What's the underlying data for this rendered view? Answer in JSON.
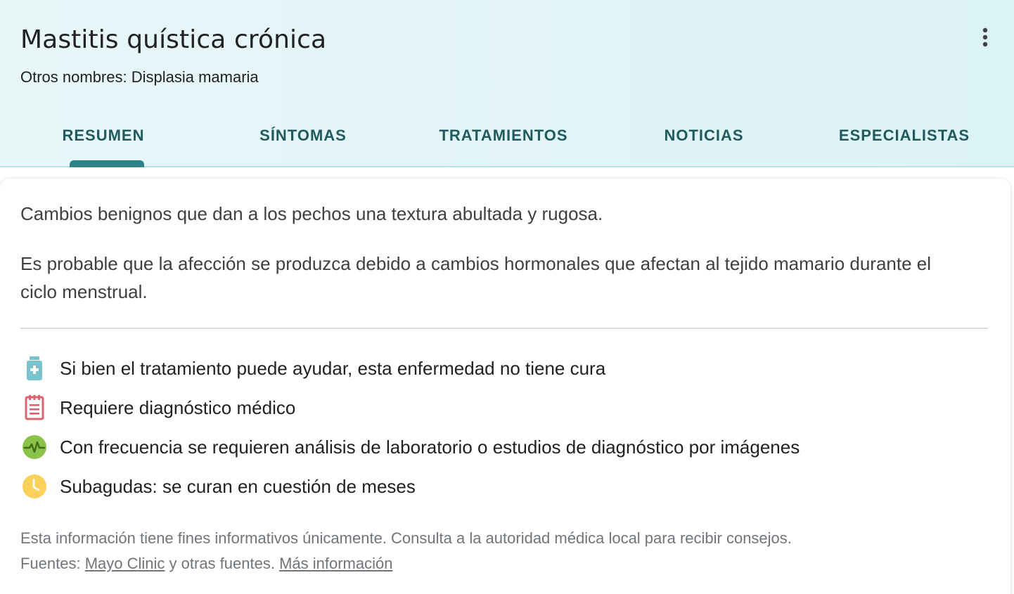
{
  "header": {
    "title": "Mastitis quística crónica",
    "subtitle": "Otros nombres: Displasia mamaria",
    "menu_icon": "more-vert-icon"
  },
  "tabs": [
    {
      "label": "RESUMEN",
      "active": true
    },
    {
      "label": "SÍNTOMAS",
      "active": false
    },
    {
      "label": "TRATAMIENTOS",
      "active": false
    },
    {
      "label": "NOTICIAS",
      "active": false
    },
    {
      "label": "ESPECIALISTAS",
      "active": false
    }
  ],
  "summary": {
    "paragraph1": "Cambios benignos que dan a los pechos una textura abultada y rugosa.",
    "paragraph2": "Es probable que la afección se produzca debido a cambios hormonales que afectan al tejido mamario durante el ciclo menstrual."
  },
  "facts": [
    {
      "icon": "medicine-bottle-icon",
      "color": "#78c3cc",
      "text": "Si bien el tratamiento puede ayudar, esta enfermedad no tiene cura"
    },
    {
      "icon": "clipboard-icon",
      "color": "#d9626f",
      "text": "Requiere diagnóstico médico"
    },
    {
      "icon": "pulse-icon",
      "color": "#8bc34a",
      "text": "Con frecuencia se requieren análisis de laboratorio o estudios de diagnóstico por imágenes"
    },
    {
      "icon": "clock-icon",
      "color": "#fbd15b",
      "text": "Subagudas: se curan en cuestión de meses"
    }
  ],
  "footer": {
    "disclaimer": "Esta información tiene fines informativos únicamente. Consulta a la autoridad médica local para recibir consejos.",
    "sources_prefix": "Fuentes: ",
    "source_link": "Mayo Clinic",
    "sources_middle": " y otras fuentes. ",
    "more_link": "Más información"
  },
  "colors": {
    "header_bg": "#dcf3f6",
    "tab_text": "#1f5a5f",
    "tab_indicator": "#2f8289"
  }
}
